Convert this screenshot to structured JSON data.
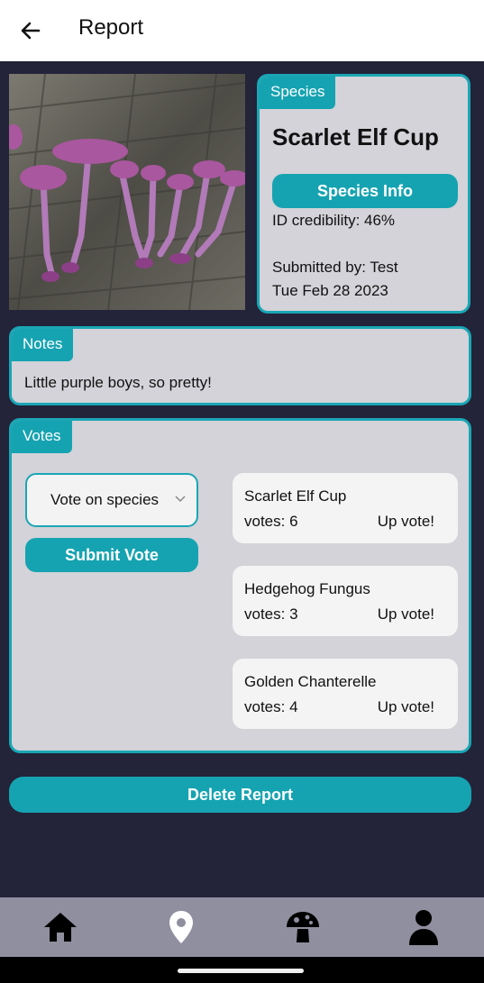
{
  "appbar": {
    "title": "Report"
  },
  "species": {
    "tag": "Species",
    "name": "Scarlet Elf Cup",
    "info_button": "Species Info",
    "credibility": "ID credibility: 46%",
    "submitted_by": "Submitted by: Test",
    "date": "Tue Feb 28 2023"
  },
  "notes": {
    "tag": "Notes",
    "text": "Little purple boys, so pretty!"
  },
  "votes": {
    "tag": "Votes",
    "select_placeholder": "Vote on species",
    "submit_label": "Submit Vote",
    "options": [
      {
        "name": "Scarlet Elf Cup",
        "votes": "votes: 6",
        "upvote": "Up vote!"
      },
      {
        "name": "Hedgehog Fungus",
        "votes": "votes: 3",
        "upvote": "Up vote!"
      },
      {
        "name": "Golden Chanterelle",
        "votes": "votes: 4",
        "upvote": "Up vote!"
      }
    ]
  },
  "delete_label": "Delete Report",
  "nav": {
    "items": [
      "home-icon",
      "map-pin-icon",
      "mushroom-icon",
      "profile-icon"
    ]
  },
  "colors": {
    "background": "#232339",
    "accent": "#16a3b1",
    "card": "#d3d3d9",
    "nav": "#8f8f9f"
  }
}
